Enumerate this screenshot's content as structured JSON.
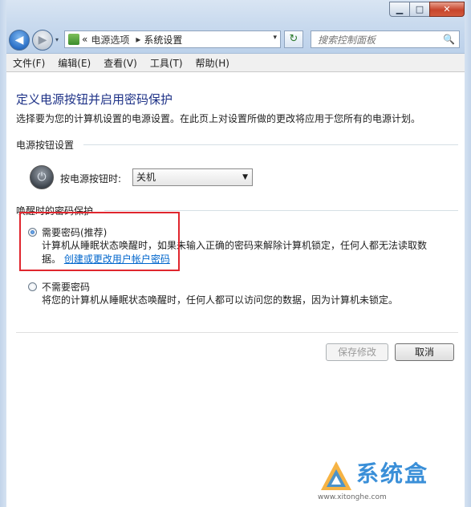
{
  "window": {
    "caption_buttons": {
      "minimize": "▁",
      "maximize": "□",
      "close": "✕"
    }
  },
  "nav": {
    "back_icon": "◀",
    "forward_icon": "▶",
    "dropdown_icon": "▾",
    "refresh_icon": "↻"
  },
  "address": {
    "prefix": "«",
    "crumbs": [
      "电源选项",
      "系统设置"
    ],
    "separator": "▸"
  },
  "search": {
    "placeholder": "搜索控制面板",
    "icon": "🔍"
  },
  "menu": {
    "items": [
      "文件(F)",
      "编辑(E)",
      "查看(V)",
      "工具(T)",
      "帮助(H)"
    ]
  },
  "main": {
    "title": "定义电源按钮并启用密码保护",
    "description": "选择要为您的计算机设置的电源设置。在此页上对设置所做的更改将应用于您所有的电源计划。",
    "power_section": {
      "header": "电源按钮设置",
      "label": "按电源按钮时:",
      "selected": "关机"
    },
    "password_section": {
      "header": "唤醒时的密码保护",
      "option_require": {
        "label": "需要密码(推荐)",
        "desc_line1": "计算机从睡眠状态唤醒时，如果未输入正确的密码来解除计算机锁定，任何人都无法读取数",
        "desc_line2_prefix": "据。",
        "link": "创建或更改用户帐户密码",
        "checked": true
      },
      "option_none": {
        "label": "不需要密码",
        "desc": "将您的计算机从睡眠状态唤醒时，任何人都可以访问您的数据，因为计算机未锁定。",
        "checked": false
      }
    },
    "buttons": {
      "save": "保存修改",
      "cancel": "取消"
    }
  },
  "watermark": {
    "text": "系统盒",
    "url": "www.xitonghe.com"
  },
  "colors": {
    "title_blue": "#1e3287",
    "link_blue": "#0066cc",
    "highlight_red": "#e0262e",
    "watermark_blue": "#3a8fd8"
  }
}
